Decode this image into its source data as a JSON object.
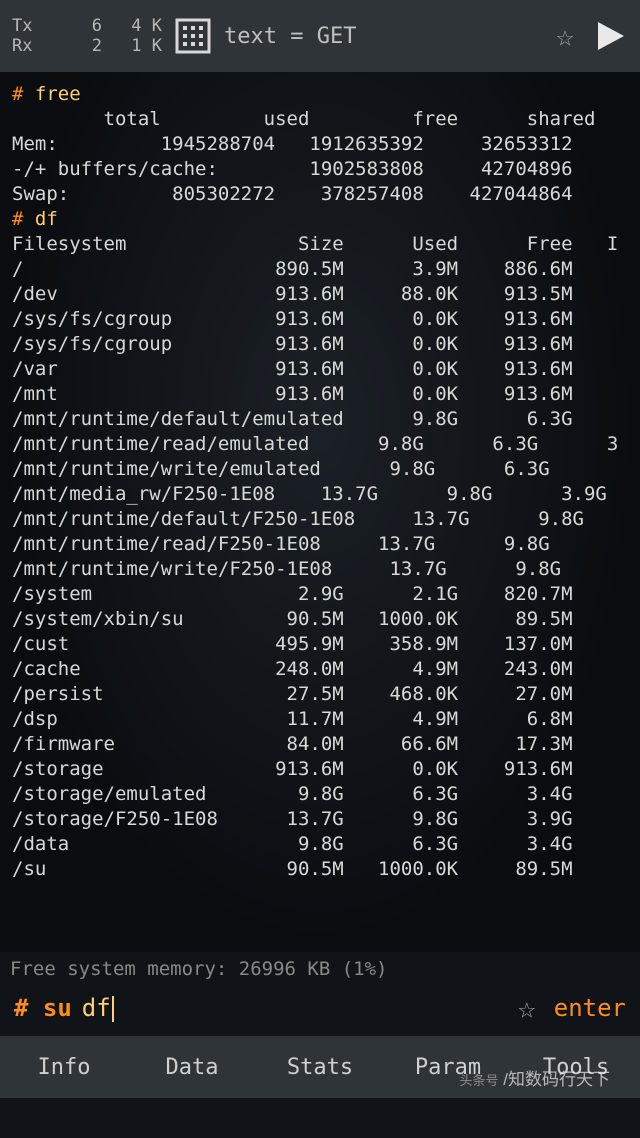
{
  "topbar": {
    "tx_label": "Tx",
    "rx_label": "Rx",
    "tx_count": "6",
    "rx_count": "2",
    "tx_rate": "4 K",
    "rx_rate": "1 K",
    "title": "text = GET"
  },
  "terminal": {
    "free_cmd": "free",
    "free_header": "        total         used         free      shared      bu",
    "free_rows": [
      "Mem:         1945288704   1912635392     32653312",
      "-/+ buffers/cache:        1902583808     42704896",
      "Swap:         805302272    378257408    427044864"
    ],
    "df_cmd": "df",
    "df_header": "Filesystem               Size      Used      Free   I",
    "df_rows": [
      "/                      890.5M      3.9M    886.6M",
      "/dev                   913.6M     88.0K    913.5M",
      "/sys/fs/cgroup         913.6M      0.0K    913.6M",
      "/sys/fs/cgroup         913.6M      0.0K    913.6M",
      "/var                   913.6M      0.0K    913.6M",
      "/mnt                   913.6M      0.0K    913.6M",
      "/mnt/runtime/default/emulated      9.8G      6.3G",
      "/mnt/runtime/read/emulated      9.8G      6.3G      3",
      "/mnt/runtime/write/emulated      9.8G      6.3G",
      "/mnt/media_rw/F250-1E08    13.7G      9.8G      3.9G",
      "/mnt/runtime/default/F250-1E08     13.7G      9.8G",
      "/mnt/runtime/read/F250-1E08     13.7G      9.8G",
      "/mnt/runtime/write/F250-1E08     13.7G      9.8G",
      "/system                  2.9G      2.1G    820.7M",
      "/system/xbin/su         90.5M   1000.0K     89.5M",
      "/cust                  495.9M    358.9M    137.0M",
      "/cache                 248.0M      4.9M    243.0M",
      "/persist                27.5M    468.0K     27.0M",
      "/dsp                    11.7M      4.9M      6.8M",
      "/firmware               84.0M     66.6M     17.3M",
      "/storage               913.6M      0.0K    913.6M",
      "/storage/emulated        9.8G      6.3G      3.4G",
      "/storage/F250-1E08      13.7G      9.8G      3.9G",
      "/data                    9.8G      6.3G      3.4G",
      "/su                     90.5M   1000.0K     89.5M"
    ]
  },
  "memstatus": "Free system memory: 26996 KB  (1%)",
  "input": {
    "prompt": "# su",
    "value": "df",
    "enter": "enter"
  },
  "tabs": [
    "Info",
    "Data",
    "Stats",
    "Param",
    "Tools"
  ],
  "watermark": {
    "small": "头条号",
    "main": "知数码行天下"
  }
}
